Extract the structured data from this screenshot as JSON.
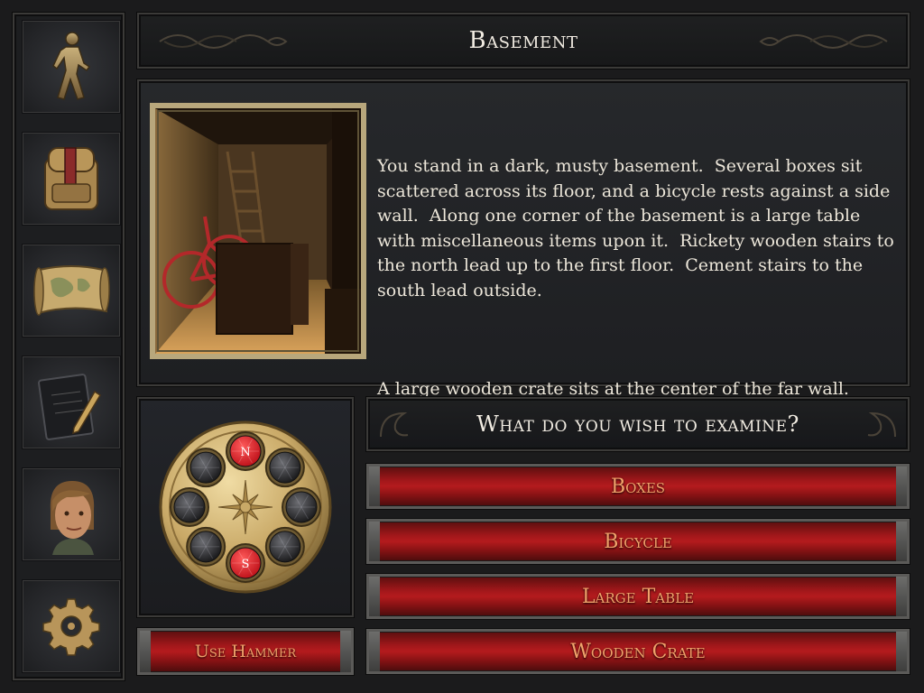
{
  "location": {
    "title": "Basement"
  },
  "sidebar": {
    "items": [
      {
        "name": "walk",
        "icon": "walking-figure-icon"
      },
      {
        "name": "inventory",
        "icon": "backpack-icon"
      },
      {
        "name": "map",
        "icon": "map-scroll-icon"
      },
      {
        "name": "journal",
        "icon": "notebook-pencil-icon"
      },
      {
        "name": "character",
        "icon": "character-portrait-icon"
      },
      {
        "name": "settings",
        "icon": "gear-icon"
      }
    ]
  },
  "description": {
    "paragraphs": [
      "You stand in a dark, musty basement.  Several boxes sit scattered across its floor, and a bicycle rests against a side wall.  Along one corner of the basement is a large table with miscellaneous items upon it.  Rickety wooden stairs to the north lead up to the first floor.  Cement stairs to the south lead outside.",
      "A large wooden crate sits at the center of the far wall."
    ]
  },
  "compass": {
    "directions": [
      {
        "id": "n",
        "label": "N",
        "active": true
      },
      {
        "id": "ne",
        "label": "",
        "active": false
      },
      {
        "id": "e",
        "label": "",
        "active": false
      },
      {
        "id": "se",
        "label": "",
        "active": false
      },
      {
        "id": "s",
        "label": "S",
        "active": true
      },
      {
        "id": "sw",
        "label": "",
        "active": false
      },
      {
        "id": "w",
        "label": "",
        "active": false
      },
      {
        "id": "nw",
        "label": "",
        "active": false
      }
    ],
    "active_color": "#c0141c",
    "inactive_color": "#1c1c1e",
    "plate_color": "#c9a967"
  },
  "actions": {
    "use_item_label": "Use Hammer"
  },
  "examine": {
    "prompt": "What do you wish to examine?",
    "choices": [
      "Boxes",
      "Bicycle",
      "Large Table",
      "Wooden Crate"
    ]
  },
  "colors": {
    "button_text": "#f0a26a",
    "button_red": "#b41b1e",
    "panel_bg": "#1d1e20",
    "text": "#ece6d9"
  }
}
